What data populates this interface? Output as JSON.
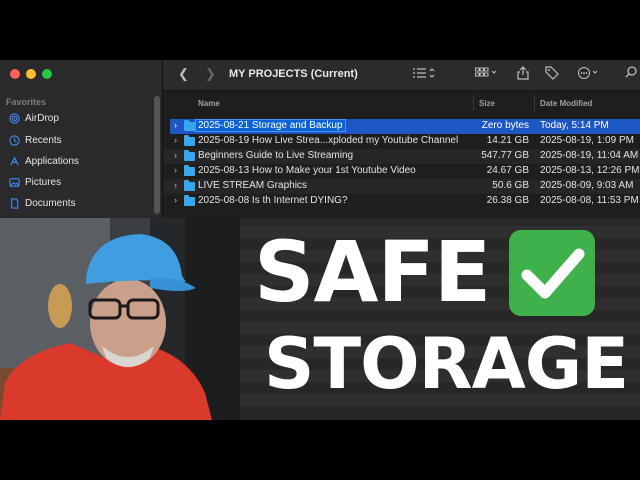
{
  "finder": {
    "title": "MY PROJECTS (Current)",
    "sidebar": {
      "section_label": "Favorites",
      "items": [
        {
          "label": "AirDrop",
          "icon": "airdrop-icon"
        },
        {
          "label": "Recents",
          "icon": "clock-icon"
        },
        {
          "label": "Applications",
          "icon": "applications-icon"
        },
        {
          "label": "Pictures",
          "icon": "pictures-icon"
        },
        {
          "label": "Documents",
          "icon": "documents-icon"
        }
      ]
    },
    "columns": {
      "name": "Name",
      "size": "Size",
      "date": "Date Modified"
    },
    "rows": [
      {
        "name": "2025-08-21 Storage and Backup",
        "size": "Zero bytes",
        "date": "Today, 5:14 PM"
      },
      {
        "name": "2025-08-19 How Live Strea...xploded my Youtube Channel",
        "size": "14.21 GB",
        "date": "2025-08-19, 1:09 PM"
      },
      {
        "name": "Beginners Guide to Live Streaming",
        "size": "547.77 GB",
        "date": "2025-08-19, 11:04 AM"
      },
      {
        "name": "2025-08-13 How to Make your 1st Youtube Video",
        "size": "24.67 GB",
        "date": "2025-08-13, 12:26 PM"
      },
      {
        "name": "LIVE STREAM Graphics",
        "size": "50.6 GB",
        "date": "2025-08-09, 9:03 AM"
      },
      {
        "name": "2025-08-08 Is th Internet DYING?",
        "size": "26.38 GB",
        "date": "2025-08-08, 11:53 PM"
      }
    ]
  },
  "overlay": {
    "line1": "SAFE",
    "line2": "STORAGE",
    "check_color": "#3fb14b"
  }
}
